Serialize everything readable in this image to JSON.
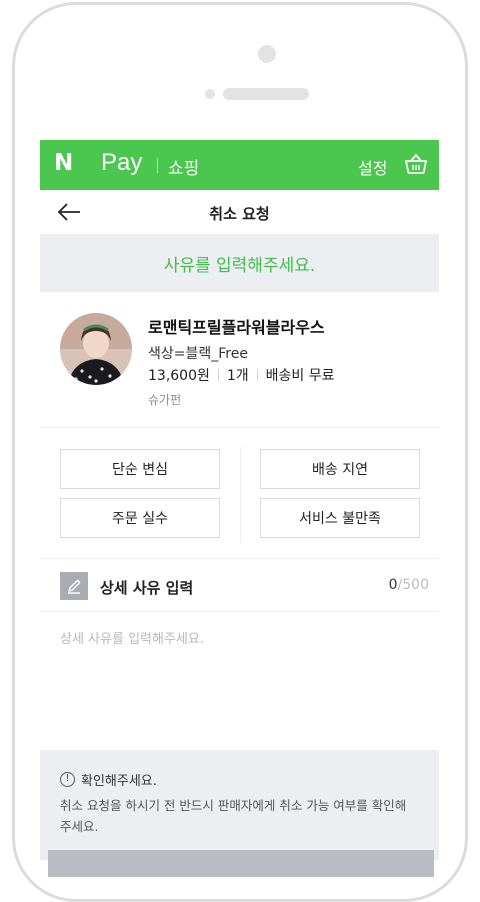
{
  "header": {
    "logo": "N",
    "brand": "Pay",
    "section": "쇼핑",
    "settings_label": "설정",
    "cart_icon": "basket-icon"
  },
  "subheader": {
    "back_icon": "arrow-left-icon",
    "title": "취소 요청"
  },
  "banner": {
    "message": "사유를 입력해주세요."
  },
  "product": {
    "name": "로맨틱프릴플라워블라우스",
    "option": "색상=블랙_Free",
    "price": "13,600원",
    "quantity": "1개",
    "shipping": "배송비 무료",
    "store": "슈가펀"
  },
  "reasons": [
    {
      "label": "단순 변심"
    },
    {
      "label": "배송 지연"
    },
    {
      "label": "주문 실수"
    },
    {
      "label": "서비스 불만족"
    }
  ],
  "detail": {
    "title": "상세 사유 입력",
    "count": "0",
    "max": "/500",
    "placeholder": "상세 사유를 입력해주세요.",
    "icon": "pencil-icon"
  },
  "notice": {
    "icon": "info-icon",
    "icon_glyph": "!",
    "title": "확인해주세요.",
    "body": "취소 요청을 하시기 전 반드시 판매자에게 취소 가능 여부를 확인해 주세요."
  },
  "colors": {
    "brand_green": "#4bc74f",
    "accent_green": "#3dbf4a",
    "banner_gray": "#edeef1"
  }
}
